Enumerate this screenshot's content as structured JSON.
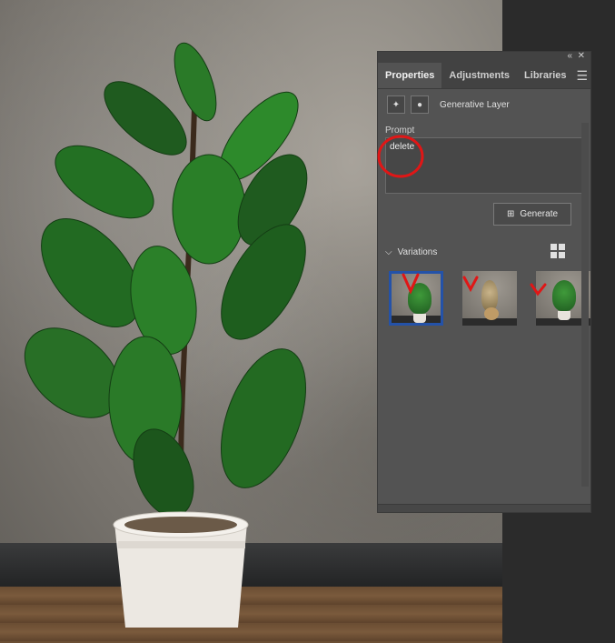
{
  "panel": {
    "collapse_icon": "double-chevron-left-icon",
    "close_icon": "close-icon",
    "tabs": [
      {
        "label": "Properties",
        "active": true
      },
      {
        "label": "Adjustments",
        "active": false
      },
      {
        "label": "Libraries",
        "active": false
      }
    ],
    "menu_icon": "hamburger-menu-icon",
    "layer": {
      "title": "Generative Layer",
      "icon_1": "magic-wand-icon",
      "icon_2": "mask-icon"
    },
    "prompt": {
      "label": "Prompt",
      "value": "delete"
    },
    "generate": {
      "label": "Generate",
      "icon": "generate-icon"
    },
    "variations": {
      "label": "Variations",
      "expanded": true,
      "grid_icon": "grid-view-icon",
      "count": 3,
      "selected_index": 0
    }
  },
  "colors": {
    "panel_bg": "#535353",
    "tab_bar": "#424242",
    "annotation_red": "#e01616",
    "selection_blue": "#2452a8"
  }
}
